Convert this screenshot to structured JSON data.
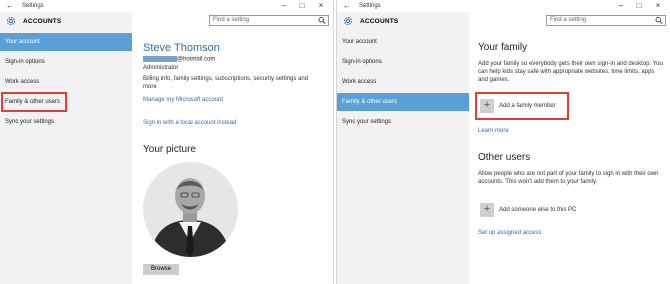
{
  "left_window": {
    "title": "Settings",
    "section_title": "ACCOUNTS",
    "search_placeholder": "Find a setting",
    "nav": [
      "Your account",
      "Sign-in options",
      "Work access",
      "Family & other users",
      "Sync your settings"
    ],
    "active_nav": "Your account",
    "highlighted_nav": "Family & other users",
    "content": {
      "user_name": "Steve Thomson",
      "email_suffix": "@hotmail.com",
      "role": "Administrator",
      "billing_text": "Billing info, family settings, subscriptions, security settings and more",
      "manage_link": "Manage my Microsoft account",
      "local_account_link": "Sign in with a local account instead",
      "picture_heading": "Your picture",
      "browse_label": "Browse"
    }
  },
  "right_window": {
    "title": "Settings",
    "section_title": "ACCOUNTS",
    "search_placeholder": "Find a setting",
    "nav": [
      "Your account",
      "Sign-in options",
      "Work access",
      "Family & other users",
      "Sync your settings"
    ],
    "active_nav": "Family & other users",
    "content": {
      "family_heading": "Your family",
      "family_text": "Add your family so everybody gets their own sign-in and desktop. You can help kids stay safe with appropriate websites, time limits, apps and games.",
      "add_family_label": "Add a family member",
      "learn_more": "Learn more",
      "other_heading": "Other users",
      "other_text": "Allow people who are not part of your family to sign in with their own accounts. This won't add them to your family.",
      "add_other_label": "Add someone else to this PC",
      "assigned_access_link": "Set up assigned access"
    }
  },
  "colors": {
    "accent": "#5aa0d8",
    "link": "#2e6fb6",
    "highlight": "#e0402f"
  }
}
